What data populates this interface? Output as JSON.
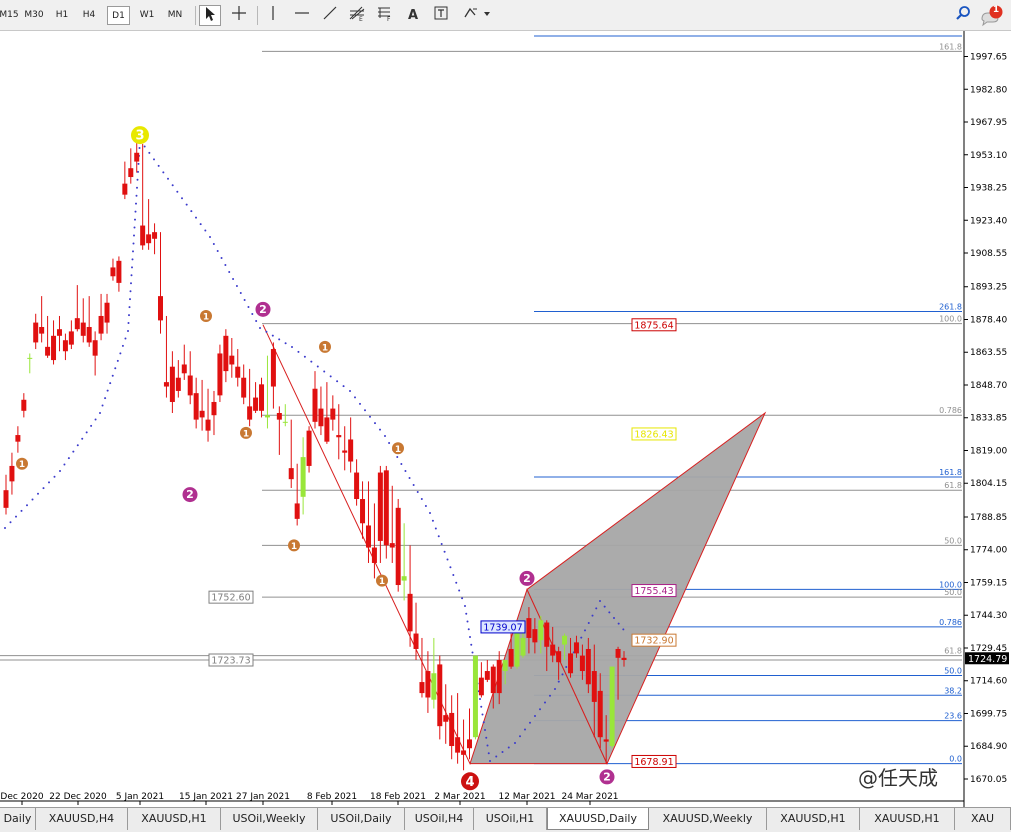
{
  "toolbar": {
    "timeframes": [
      "M15",
      "M30",
      "H1",
      "H4",
      "D1",
      "W1",
      "MN"
    ],
    "active_timeframe": "D1",
    "tools": [
      "cursor-icon",
      "crosshair-icon",
      "vertical-line-icon",
      "horizontal-line-icon",
      "trendline-icon",
      "fibonacci-fan-icon",
      "fibonacci-retracement-icon",
      "text-icon",
      "text-label-icon",
      "shapes-dropdown-icon"
    ],
    "search_icon": "search-icon",
    "notification_count": "1"
  },
  "chart_data": {
    "type": "candlestick",
    "symbol": "XAUUSD",
    "timeframe": "Daily",
    "ylim": [
      1674.0,
      2010.0
    ],
    "price_axis_labels": [
      "1997.65",
      "1982.80",
      "1967.95",
      "1953.10",
      "1938.25",
      "1923.40",
      "1908.55",
      "1893.25",
      "1878.40",
      "1863.55",
      "1848.70",
      "1833.85",
      "1819.00",
      "1804.15",
      "1788.85",
      "1774.00",
      "1759.15",
      "1744.30",
      "1729.45",
      "1714.60",
      "1699.75",
      "1684.90",
      "1670.05"
    ],
    "current_price": "1724.79",
    "x_labels": [
      "Dec 2020",
      "22 Dec 2020",
      "5 Jan 2021",
      "15 Jan 2021",
      "27 Jan 2021",
      "8 Feb 2021",
      "18 Feb 2021",
      "2 Mar 2021",
      "12 Mar 2021",
      "24 Mar 2021"
    ],
    "candles": [
      [
        1801,
        1808,
        1793,
        1790
      ],
      [
        1812,
        1818,
        1805,
        1799
      ],
      [
        1826,
        1830,
        1823,
        1818
      ],
      [
        1842,
        1845,
        1837,
        1834
      ],
      [
        1861,
        1863,
        1861,
        1854
      ],
      [
        1877,
        1881,
        1868,
        1865
      ],
      [
        1875,
        1889,
        1872,
        1868
      ],
      [
        1866,
        1880,
        1862,
        1861
      ],
      [
        1871,
        1878,
        1860,
        1858
      ],
      [
        1874,
        1880,
        1871,
        1864
      ],
      [
        1869,
        1872,
        1864,
        1860
      ],
      [
        1873,
        1878,
        1867,
        1865
      ],
      [
        1879,
        1894,
        1874,
        1873
      ],
      [
        1877,
        1888,
        1871,
        1868
      ],
      [
        1875,
        1889,
        1868,
        1866
      ],
      [
        1869,
        1873,
        1862,
        1853
      ],
      [
        1880,
        1890,
        1872,
        1869
      ],
      [
        1886,
        1890,
        1877,
        1872
      ],
      [
        1902,
        1906,
        1898,
        1896
      ],
      [
        1905,
        1907,
        1895,
        1891
      ],
      [
        1940,
        1950,
        1935,
        1933
      ],
      [
        1947,
        1956,
        1943,
        1940
      ],
      [
        1954,
        1960,
        1950,
        1945
      ],
      [
        1921,
        1958,
        1912,
        1910
      ],
      [
        1917,
        1933,
        1913,
        1910
      ],
      [
        1918,
        1922,
        1915,
        1908
      ],
      [
        1889,
        1918,
        1878,
        1872
      ],
      [
        1850,
        1880,
        1848,
        1843
      ],
      [
        1857,
        1864,
        1841,
        1836
      ],
      [
        1852,
        1860,
        1846,
        1843
      ],
      [
        1858,
        1867,
        1854,
        1851
      ],
      [
        1853,
        1864,
        1844,
        1840
      ],
      [
        1845,
        1852,
        1833,
        1829
      ],
      [
        1837,
        1851,
        1834,
        1828
      ],
      [
        1833,
        1847,
        1828,
        1823
      ],
      [
        1841,
        1846,
        1835,
        1826
      ],
      [
        1863,
        1867,
        1844,
        1841
      ],
      [
        1871,
        1874,
        1855,
        1850
      ],
      [
        1862,
        1870,
        1858,
        1852
      ],
      [
        1857,
        1865,
        1852,
        1848
      ],
      [
        1852,
        1858,
        1843,
        1840
      ],
      [
        1839,
        1856,
        1833,
        1830
      ],
      [
        1843,
        1850,
        1837,
        1836
      ],
      [
        1849,
        1852,
        1837,
        1834
      ],
      [
        1834,
        1862,
        1835,
        1829
      ],
      [
        1865,
        1868,
        1848,
        1838
      ],
      [
        1836,
        1839,
        1833,
        1817
      ],
      [
        1832,
        1840,
        1832,
        1830
      ],
      [
        1811,
        1833,
        1806,
        1802
      ],
      [
        1795,
        1813,
        1788,
        1785
      ],
      [
        1798,
        1825,
        1816,
        1790
      ],
      [
        1828,
        1830,
        1812,
        1809
      ],
      [
        1847,
        1855,
        1832,
        1829
      ],
      [
        1838,
        1848,
        1830,
        1826
      ],
      [
        1834,
        1850,
        1823,
        1822
      ],
      [
        1838,
        1844,
        1833,
        1828
      ],
      [
        1826,
        1840,
        1825,
        1815
      ],
      [
        1819,
        1830,
        1818,
        1810
      ],
      [
        1824,
        1834,
        1814,
        1809
      ],
      [
        1809,
        1815,
        1797,
        1794
      ],
      [
        1797,
        1805,
        1786,
        1779
      ],
      [
        1785,
        1805,
        1775,
        1768
      ],
      [
        1775,
        1795,
        1768,
        1761
      ],
      [
        1809,
        1812,
        1778,
        1768
      ],
      [
        1810,
        1812,
        1776,
        1770
      ],
      [
        1777,
        1803,
        1775,
        1768
      ],
      [
        1793,
        1797,
        1758,
        1755
      ],
      [
        1760,
        1786,
        1762,
        1751
      ],
      [
        1754,
        1776,
        1737,
        1730
      ],
      [
        1736,
        1750,
        1729,
        1724
      ],
      [
        1714,
        1734,
        1709,
        1707
      ],
      [
        1719,
        1728,
        1707,
        1700
      ],
      [
        1706,
        1734,
        1718,
        1702
      ],
      [
        1722,
        1726,
        1694,
        1688
      ],
      [
        1699,
        1713,
        1696,
        1686
      ],
      [
        1700,
        1708,
        1685,
        1679
      ],
      [
        1689,
        1709,
        1682,
        1677
      ],
      [
        1683,
        1697,
        1681,
        1674
      ],
      [
        1688,
        1702,
        1684,
        1679
      ],
      [
        1689,
        1712,
        1726,
        1688
      ],
      [
        1716,
        1723,
        1708,
        1707
      ],
      [
        1719,
        1724,
        1715,
        1714
      ],
      [
        1721,
        1722,
        1709,
        1702
      ],
      [
        1724,
        1728,
        1709,
        1704
      ],
      [
        1719,
        1724,
        1724,
        1713
      ],
      [
        1729,
        1736,
        1721,
        1720
      ],
      [
        1721,
        1733,
        1738,
        1720
      ],
      [
        1726,
        1742,
        1734,
        1725
      ],
      [
        1743,
        1748,
        1734,
        1727
      ],
      [
        1738,
        1743,
        1732,
        1727
      ],
      [
        1733,
        1744,
        1742,
        1727
      ],
      [
        1741,
        1742,
        1730,
        1719
      ],
      [
        1731,
        1739,
        1726,
        1723
      ],
      [
        1728,
        1730,
        1723,
        1715
      ],
      [
        1731,
        1736,
        1735,
        1724
      ],
      [
        1727,
        1734,
        1718,
        1716
      ],
      [
        1732,
        1735,
        1727,
        1725
      ],
      [
        1726,
        1731,
        1719,
        1715
      ],
      [
        1729,
        1734,
        1713,
        1709
      ],
      [
        1719,
        1731,
        1705,
        1689
      ],
      [
        1710,
        1718,
        1689,
        1684
      ],
      [
        1688,
        1699,
        1687,
        1677
      ],
      [
        1685,
        1719,
        1721,
        1684
      ],
      [
        1729,
        1730,
        1725,
        1706
      ],
      [
        1725,
        1728,
        1724,
        1721
      ]
    ],
    "harmonic_patterns": [
      {
        "name": "butterfly-left",
        "points": [
          [
            "27 Jan 2021",
            1876
          ],
          [
            "5 Mar 2021",
            1677
          ],
          [
            "12 Mar 2021",
            1756
          ],
          [
            "26 Mar 2021",
            1677
          ],
          [
            "5 Mar 2021",
            1677
          ]
        ]
      },
      {
        "name": "butterfly-right",
        "points": [
          [
            "12 Mar 2021",
            1756
          ],
          [
            "26 Mar 2021",
            1677
          ],
          [
            "16 Apr 2021",
            1836
          ]
        ]
      }
    ],
    "fibonacci_levels": [
      {
        "label": "161.8",
        "price": 2000.0
      },
      {
        "label": "261.8",
        "price": 1882.0
      },
      {
        "label": "100.0",
        "price": 1876.5
      },
      {
        "label": "0.786",
        "price": 1835.0
      },
      {
        "label": "161.8",
        "price": 1807.0
      },
      {
        "label": "61.8",
        "price": 1801.0
      },
      {
        "label": "50.0",
        "price": 1776.0
      },
      {
        "label": "100.0",
        "price": 1756.0
      },
      {
        "label": "50.0",
        "price": 1752.5
      },
      {
        "label": "0.786",
        "price": 1739.0
      },
      {
        "label": "61.8",
        "price": 1726.0
      },
      {
        "label": "50.0",
        "price": 1717.0
      },
      {
        "label": "38.2",
        "price": 1708.0
      },
      {
        "label": "23.6",
        "price": 1696.5
      },
      {
        "label": "0.0",
        "price": 1677.0
      }
    ],
    "price_boxes": [
      {
        "label": "1875.64",
        "color": "#cc0000"
      },
      {
        "label": "1826.43",
        "color": "#e6e600"
      },
      {
        "label": "1755.43",
        "color": "#aa2288"
      },
      {
        "label": "1739.07",
        "color": "#0000cc"
      },
      {
        "label": "1732.90",
        "color": "#c87832"
      },
      {
        "label": "1752.60",
        "color": "#808080"
      },
      {
        "label": "1723.73",
        "color": "#808080"
      },
      {
        "label": "1678.91",
        "color": "#cc0000"
      }
    ],
    "wave_labels": [
      {
        "text": "3",
        "color": "#e8e800",
        "date": "5 Jan 2021",
        "price": 1962
      },
      {
        "text": "2",
        "color": "#b03090",
        "date": "27 Jan 2021",
        "price": 1883
      },
      {
        "text": "2",
        "color": "#b03090",
        "date": "14 Jan 2021",
        "price": 1799
      },
      {
        "text": "2",
        "color": "#b03090",
        "date": "12 Mar 2021",
        "price": 1761
      },
      {
        "text": "2",
        "color": "#b03090",
        "date": "26 Mar 2021",
        "price": 1671
      },
      {
        "text": "4",
        "color": "#cc1111",
        "date": "5 Mar 2021",
        "price": 1669
      },
      {
        "text": "1",
        "color": "#c87832",
        "date": "15 Jan 2021",
        "price": 1880
      },
      {
        "text": "1",
        "color": "#c87832",
        "date": "2 Feb 2021",
        "price": 1866
      },
      {
        "text": "1",
        "color": "#c87832",
        "date": "18 Feb 2021",
        "price": 1820
      },
      {
        "text": "1",
        "color": "#c87832",
        "date": "16 Feb 2021",
        "price": 1760
      },
      {
        "text": "1",
        "color": "#c87832",
        "date": "20 Jan 2021",
        "price": 1827
      },
      {
        "text": "1",
        "color": "#c87832",
        "date": "28 Jan 2021",
        "price": 1776
      },
      {
        "text": "1",
        "color": "#c87832",
        "date": "Dec 2020",
        "price": 1813
      }
    ],
    "colors": {
      "bull": "#99e63a",
      "bear": "#e01010",
      "pattern_fill": "#a6a6a6",
      "pattern_edge": "#d82020",
      "sar_dots": "#3a3acc",
      "fib_blue": "#2060d0",
      "fib_gray": "#909090"
    }
  },
  "tabs": [
    "Daily",
    "XAUUSD,H4",
    "XAUUSD,H1",
    "USOil,Weekly",
    "USOil,Daily",
    "USOil,H4",
    "USOil,H1",
    "XAUUSD,Daily",
    "XAUUSD,Weekly",
    "XAUUSD,H1",
    "XAUUSD,H1",
    "XAU"
  ],
  "active_tab": "XAUUSD,Daily",
  "watermark": "@任天成"
}
